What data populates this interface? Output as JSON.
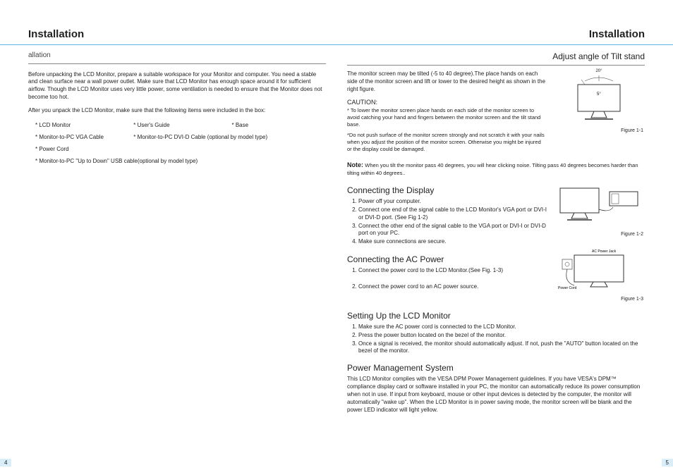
{
  "header": {
    "left": "Installation",
    "right": "Installation"
  },
  "leftPage": {
    "fragment": "allation",
    "intro": "Before unpacking the LCD Monitor, prepare a suitable workspace for your Monitor and computer. You need a stable and clean surface near a wall power outlet. Make sure that LCD Monitor has enough space around it for sufficient airflow. Though the LCD Monitor uses very little power, some ventilation is needed to ensure that the Monitor does not become too hot.",
    "afterUnpack": "After you unpack the LCD Monitor, make sure that the following items were included in the box:",
    "items": {
      "a": "*   LCD Monitor",
      "b": "*   User's Guide",
      "c": "*   Base",
      "d": "*   Monitor-to-PC VGA Cable",
      "e": "*   Monitor-to-PC DVI-D Cable (optional by model type)",
      "f": "*   Power Cord",
      "g": "*   Monitor-to-PC \"Up to Down\" USB cable(optional by model type)"
    },
    "pageNum": "4"
  },
  "rightPage": {
    "tiltTitle": "Adjust angle of Tilt stand",
    "tiltText": "The monitor screen may be tilted (-5 to 40 degree).The place hands on each side of the monitor screen and lift or lower to the desired height as shown in the right figure.",
    "tiltDeg1": "20°",
    "tiltDeg2": "5°",
    "fig1": "Figure 1-1",
    "cautionH": "CAUTION:",
    "caution1": "* To lower the monitor screen place hands on each side of the monitor screen to avoid catching your hand and fingers between the monitor screen and the tilt stand base.",
    "caution2": "*Do not push surface of the monitor screen strongly and not scratch it with your nails when you adjust the position of the monitor screen. Otherwise you might be injured or the display could be damaged.",
    "noteLabel": "Note:",
    "noteText": "When you tilt the monitor pass 40 degrees, you will hear clicking noise. Tilting pass 40 degrees becomes harder than tilting within 40 degrees..",
    "connDispH": "Connecting the Display",
    "connDisp": {
      "1": "Power off your computer.",
      "2": "Connect one end of the signal cable to the LCD Monitor's VGA port or DVI-I or DVI-D port. (See Fig 1-2)",
      "3": "Connect the other end of the signal cable to the VGA port or DVI-I or DVI-D port on your PC.",
      "4": "Make sure connections are secure."
    },
    "fig2": "Figure 1-2",
    "connAcH": "Connecting the AC Power",
    "connAc": {
      "1": "Connect the power cord to the LCD Monitor.(See Fig. 1-3)",
      "2": "Connect the power cord to an AC power source."
    },
    "fig3lbl1": "AC Power Jack",
    "fig3lbl2": "Power Cord",
    "fig3": "Figure 1-3",
    "setupH": "Setting Up the LCD Monitor",
    "setup": {
      "1": "Make sure the AC power cord is connected to the LCD Monitor.",
      "2": "Press the power button located on the bezel of the monitor.",
      "3": "Once a signal is received, the monitor should automatically adjust. If not, push the \"AUTO\" button located on the bezel of the monitor."
    },
    "pmsH": "Power Management System",
    "pmsText": "This LCD Monitor complies with the VESA DPM Power Management guidelines. If you have VESA's DPM™ compliance display card or software installed in your PC, the monitor can automatically reduce its power consumption when not in use. If input from keyboard, mouse or other input devices is detected by the computer, the monitor will automatically \"wake up\". When the LCD Monitor is in power saving mode, the monitor screen will be blank and the power LED indicator will light yellow.",
    "pageNum": "5"
  }
}
